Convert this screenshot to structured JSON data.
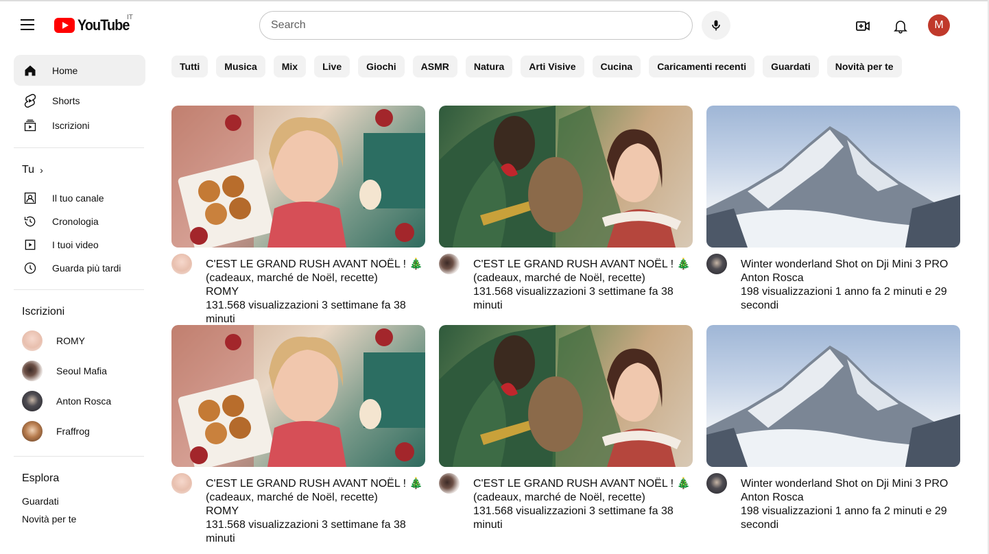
{
  "header": {
    "logo_text": "YouTube",
    "country": "IT",
    "search_placeholder": "Search",
    "avatar_letter": "M"
  },
  "sidebar": {
    "main": [
      {
        "label": "Home",
        "icon": "home-icon"
      },
      {
        "label": "Shorts",
        "icon": "shorts-icon"
      },
      {
        "label": "Iscrizioni",
        "icon": "subscriptions-icon"
      }
    ],
    "you_heading": "Tu",
    "you_items": [
      {
        "label": "Il tuo canale",
        "icon": "channel-icon"
      },
      {
        "label": "Cronologia",
        "icon": "history-icon"
      },
      {
        "label": "I tuoi video",
        "icon": "your-videos-icon"
      },
      {
        "label": "Guarda più tardi",
        "icon": "watch-later-icon"
      }
    ],
    "subs_heading": "Iscrizioni",
    "subscriptions": [
      {
        "label": "ROMY"
      },
      {
        "label": "Seoul Mafia"
      },
      {
        "label": "Anton Rosca"
      },
      {
        "label": "Fraffrog"
      }
    ],
    "explore_heading": "Esplora",
    "explore_items": [
      {
        "label": "Guardati"
      },
      {
        "label": "Novità per te"
      }
    ]
  },
  "chips": [
    "Tutti",
    "Musica",
    "Mix",
    "Live",
    "Giochi",
    "ASMR",
    "Natura",
    "Arti Visive",
    "Cucina",
    "Caricamenti recenti",
    "Guardati",
    "Novità per te"
  ],
  "videos": [
    {
      "title": "C'EST LE GRAND RUSH AVANT NOËL ! 🎄 (cadeaux, marché de Noël, recette)",
      "channel": "ROMY",
      "stats": "131.568 visualizzazioni 3 settimane fa 38 minuti"
    },
    {
      "title": "C'EST LE GRAND RUSH AVANT NOËL ! 🎄 (cadeaux, marché de Noël, recette)",
      "channel": "",
      "stats": "131.568 visualizzazioni 3 settimane fa 38 minuti"
    },
    {
      "title": "Winter wonderland Shot on Dji Mini 3 PRO",
      "channel": "Anton Rosca",
      "stats": "198 visualizzazioni 1 anno fa 2 minuti e 29 secondi"
    },
    {
      "title": "C'EST LE GRAND RUSH AVANT NOËL ! 🎄 (cadeaux, marché de Noël, recette)",
      "channel": "ROMY",
      "stats": "131.568 visualizzazioni 3 settimane fa 38 minuti"
    },
    {
      "title": "C'EST LE GRAND RUSH AVANT NOËL ! 🎄 (cadeaux, marché de Noël, recette)",
      "channel": "",
      "stats": "131.568 visualizzazioni 3 settimane fa 38 minuti"
    },
    {
      "title": "Winter wonderland Shot on Dji Mini 3 PRO",
      "channel": "Anton Rosca",
      "stats": "198 visualizzazioni 1 anno fa 2 minuti e 29 secondi"
    }
  ],
  "colors": {
    "brand_red": "#ff0000",
    "avatar_bg": "#c0392b",
    "chip_bg": "#f2f2f2"
  }
}
